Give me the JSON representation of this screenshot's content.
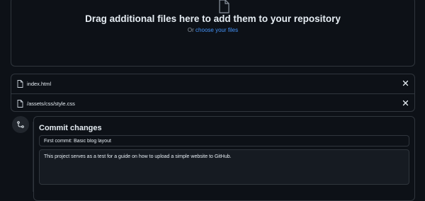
{
  "dropzone": {
    "title": "Drag additional files here to add them to your repository",
    "prefix": "Or",
    "link": "choose your files",
    "icon": "file-icon"
  },
  "files": [
    {
      "name": "index.html",
      "icon": "file-icon",
      "remove_icon": "close-icon"
    },
    {
      "name": "/assets/css/style.css",
      "icon": "file-icon",
      "remove_icon": "close-icon"
    }
  ],
  "commit": {
    "icon": "git-commit-icon",
    "title": "Commit changes",
    "summary_value": "First commit: Basic blog layout",
    "description_parts": {
      "a": "This project serves as a test for a guide on how to upload a simple website to GitHub."
    },
    "description_value": "This project serves as a test for a guide on how to upload a simple website to GitHub."
  },
  "colors": {
    "background": "#0d1117",
    "border": "#30363d",
    "link": "#4493f8",
    "text": "#e6edf3",
    "muted": "#8b949e"
  }
}
